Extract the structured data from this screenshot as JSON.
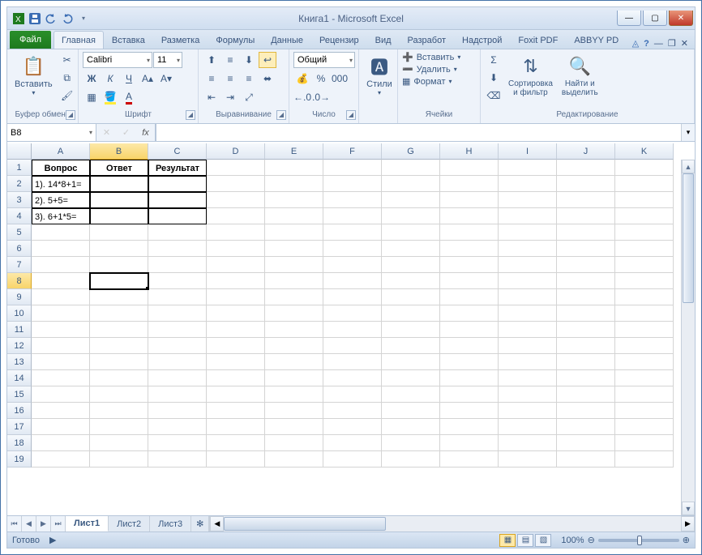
{
  "window": {
    "title": "Книга1  -  Microsoft Excel"
  },
  "qat": {
    "save": "save-icon",
    "undo": "undo-icon",
    "redo": "redo-icon"
  },
  "tabs": {
    "file": "Файл",
    "items": [
      "Главная",
      "Вставка",
      "Разметка",
      "Формулы",
      "Данные",
      "Рецензир",
      "Вид",
      "Разработ",
      "Надстрой",
      "Foxit PDF",
      "ABBYY PD"
    ],
    "active_index": 0
  },
  "ribbon": {
    "clipboard": {
      "paste": "Вставить",
      "label": "Буфер обмена"
    },
    "font": {
      "name": "Calibri",
      "size": "11",
      "label": "Шрифт",
      "bold": "Ж",
      "italic": "К",
      "underline": "Ч"
    },
    "align": {
      "label": "Выравнивание"
    },
    "number": {
      "format": "Общий",
      "label": "Число"
    },
    "styles": {
      "btn": "Стили"
    },
    "cells": {
      "insert": "Вставить",
      "delete": "Удалить",
      "format": "Формат",
      "label": "Ячейки"
    },
    "editing": {
      "sort": "Сортировка\nи фильтр",
      "find": "Найти и\nвыделить",
      "label": "Редактирование"
    }
  },
  "namebox": "B8",
  "fx_label": "fx",
  "columns": [
    "A",
    "B",
    "C",
    "D",
    "E",
    "F",
    "G",
    "H",
    "I",
    "J",
    "K"
  ],
  "rows_count": 19,
  "active_cell": {
    "row": 8,
    "col": 2
  },
  "cells": {
    "headers": [
      "Вопрос",
      "Ответ",
      "Результат"
    ],
    "data": [
      [
        "1). 14*8+1=",
        "",
        ""
      ],
      [
        "2). 5+5=",
        "",
        ""
      ],
      [
        "3). 6+1*5=",
        "",
        ""
      ]
    ]
  },
  "sheets": {
    "items": [
      "Лист1",
      "Лист2",
      "Лист3"
    ],
    "active_index": 0
  },
  "status": {
    "ready": "Готово",
    "zoom": "100%"
  }
}
